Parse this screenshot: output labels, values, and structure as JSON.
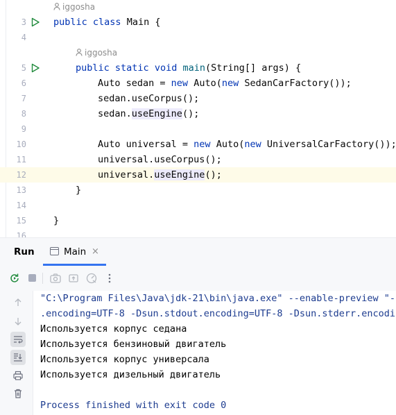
{
  "editor": {
    "author_hints": [
      "iggosha",
      "iggosha"
    ],
    "line_numbers": [
      "3",
      "4",
      "5",
      "6",
      "7",
      "8",
      "9",
      "10",
      "11",
      "12",
      "13",
      "14",
      "15",
      "16"
    ],
    "lines": {
      "l3": {
        "kw1": "public",
        "kw2": "class",
        "rest": " Main {"
      },
      "l5": {
        "kw1": "public",
        "kw2": "static",
        "kw3": "void",
        "fn": "main",
        "rest": "(String[] args) {"
      },
      "l6": {
        "a": "Auto sedan = ",
        "kw": "new",
        "b": " Auto(",
        "kw2": "new",
        "c": " SedanCarFactory());"
      },
      "l7": {
        "a": "sedan.useCorpus();"
      },
      "l8": {
        "a": "sedan.",
        "hl": "useEngine",
        "b": "();"
      },
      "l10": {
        "a": "Auto universal = ",
        "kw": "new",
        "b": " Auto(",
        "kw2": "new",
        "c": " UniversalCarFactory());"
      },
      "l11": {
        "a": "universal.useCorpus();"
      },
      "l12": {
        "a": "universal.",
        "hl": "useEngine",
        "b": "();"
      },
      "l13": {
        "a": "}"
      },
      "l15": {
        "a": "}"
      }
    }
  },
  "run_panel": {
    "title": "Run",
    "tab_label": "Main",
    "tab_close": "×"
  },
  "console": {
    "cmd_line1": "\"C:\\Program Files\\Java\\jdk-21\\bin\\java.exe\" --enable-preview \"-j",
    "cmd_line2": ".encoding=UTF-8 -Dsun.stdout.encoding=UTF-8 -Dsun.stderr.encodi",
    "outputs": [
      "Используется корпус седана",
      "Используется бензиновый двигатель",
      "Используется корпус универсала",
      "Используется дизельный двигатель"
    ],
    "exit": "Process finished with exit code 0"
  }
}
